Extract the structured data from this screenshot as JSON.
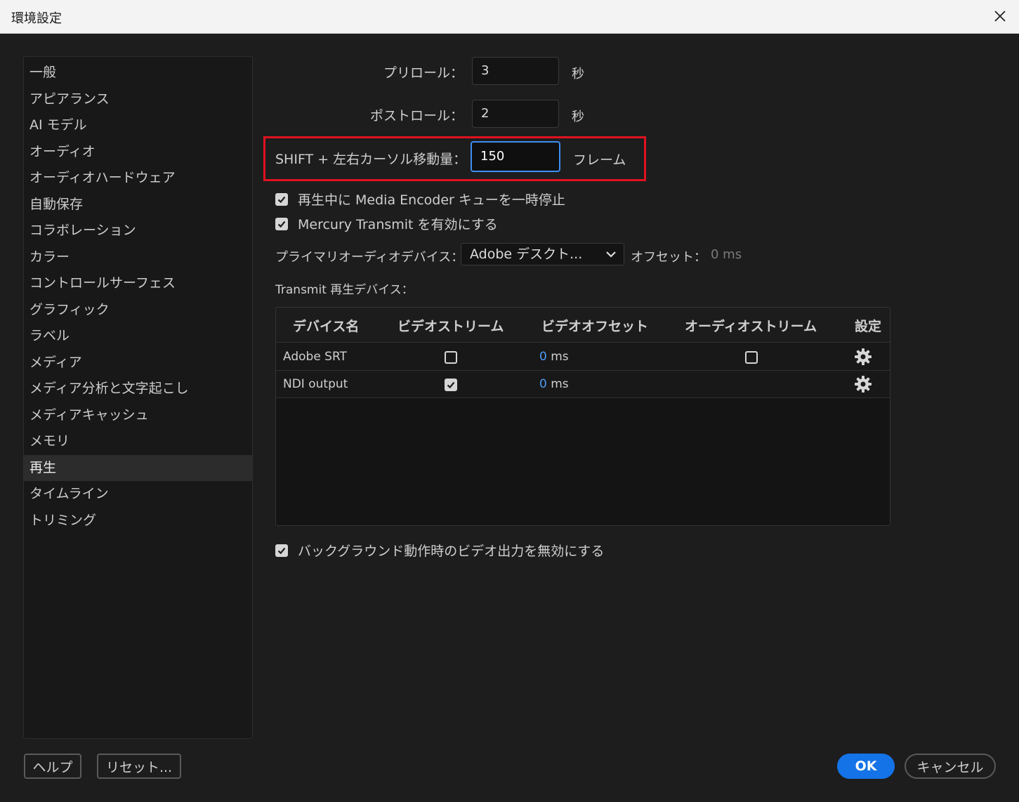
{
  "window": {
    "title": "環境設定",
    "close_icon": "close-icon"
  },
  "sidebar": {
    "items": [
      {
        "label": "一般"
      },
      {
        "label": "アピアランス"
      },
      {
        "label": "AI モデル"
      },
      {
        "label": "オーディオ"
      },
      {
        "label": "オーディオハードウェア"
      },
      {
        "label": "自動保存"
      },
      {
        "label": "コラボレーション"
      },
      {
        "label": "カラー"
      },
      {
        "label": "コントロールサーフェス"
      },
      {
        "label": "グラフィック"
      },
      {
        "label": "ラベル"
      },
      {
        "label": "メディア"
      },
      {
        "label": "メディア分析と文字起こし"
      },
      {
        "label": "メディアキャッシュ"
      },
      {
        "label": "メモリ"
      },
      {
        "label": "再生"
      },
      {
        "label": "タイムライン"
      },
      {
        "label": "トリミング"
      }
    ],
    "selected": "再生"
  },
  "playback": {
    "preroll": {
      "label": "プリロール：",
      "value": "3",
      "unit": "秒"
    },
    "postroll": {
      "label": "ポストロール：",
      "value": "2",
      "unit": "秒"
    },
    "shift_step": {
      "label": "SHIFT + 左右カーソル移動量：",
      "value": "150",
      "unit": "フレーム"
    },
    "pause_media_encoder": {
      "label": "再生中に Media Encoder キューを一時停止",
      "checked": true
    },
    "enable_mercury": {
      "label": "Mercury Transmit を有効にする",
      "checked": true
    },
    "primary_audio": {
      "label": "プライマリオーディオデバイス：",
      "value": "Adobe デスクト...",
      "offset_label": "オフセット：",
      "offset_value": "0 ms"
    },
    "transmit_label": "Transmit 再生デバイス：",
    "disable_background": {
      "label": "バックグラウンド動作時のビデオ出力を無効にする",
      "checked": true
    }
  },
  "devices_table": {
    "headers": [
      "デバイス名",
      "ビデオストリーム",
      "ビデオオフセット",
      "オーディオストリーム",
      "設定"
    ],
    "rows": [
      {
        "name": "Adobe SRT",
        "video_stream": false,
        "offset_num": "0",
        "offset_unit": " ms",
        "audio_stream": false
      },
      {
        "name": "NDI output",
        "video_stream": true,
        "offset_num": "0",
        "offset_unit": " ms"
      }
    ]
  },
  "footer": {
    "help_label": "ヘルプ",
    "reset_label": "リセット...",
    "ok_label": "OK",
    "cancel_label": "キャンセル"
  },
  "colors": {
    "accent": "#1473e6",
    "focus": "#3d8ef0",
    "highlight": "#e0121f",
    "link": "#4f9cf5"
  }
}
